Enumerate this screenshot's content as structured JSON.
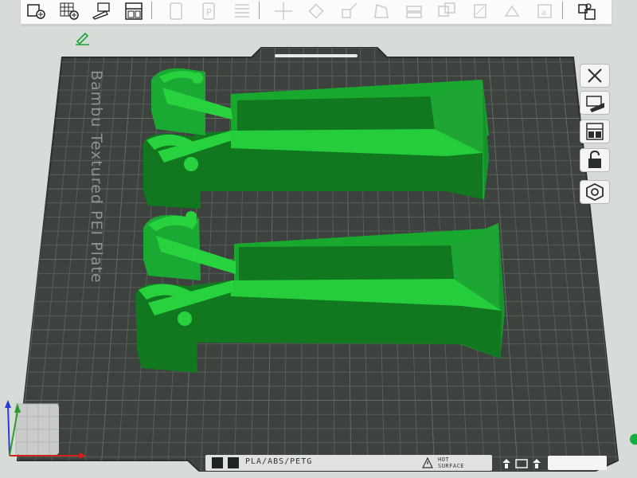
{
  "toolbar": {
    "groups": [
      [
        "add-object-icon",
        "add-plate-icon",
        "auto-orient-icon",
        "arrange-icon"
      ],
      [
        "object-list-icon",
        "plate-p-icon",
        "layers-icon"
      ],
      [
        "move-icon",
        "rotate-icon",
        "scale-icon",
        "lay-on-face-icon",
        "cut-icon",
        "boolean-icon",
        "support-paint-icon",
        "seam-paint-icon",
        "text-emboss-icon"
      ],
      [
        "assembly-icon"
      ]
    ]
  },
  "plate": {
    "label": "Bambu Textured PEI Plate",
    "material": "PLA/ABS/PETG",
    "surface_line1": "HOT",
    "surface_line2": "SURFACE"
  },
  "side_toolbar": [
    "close-icon",
    "auto-orient-plate-icon",
    "arrange-plate-icon",
    "lock-plate-icon",
    "plate-settings-icon"
  ],
  "colors": {
    "plate": "#3d423f",
    "grid": "#575d59",
    "model_light": "#28d23e",
    "model_dark": "#11781f",
    "background": "#d7dcd9",
    "axis_x": "#d21f1f",
    "axis_y": "#2f9a2f",
    "axis_z": "#2b3dd0"
  }
}
